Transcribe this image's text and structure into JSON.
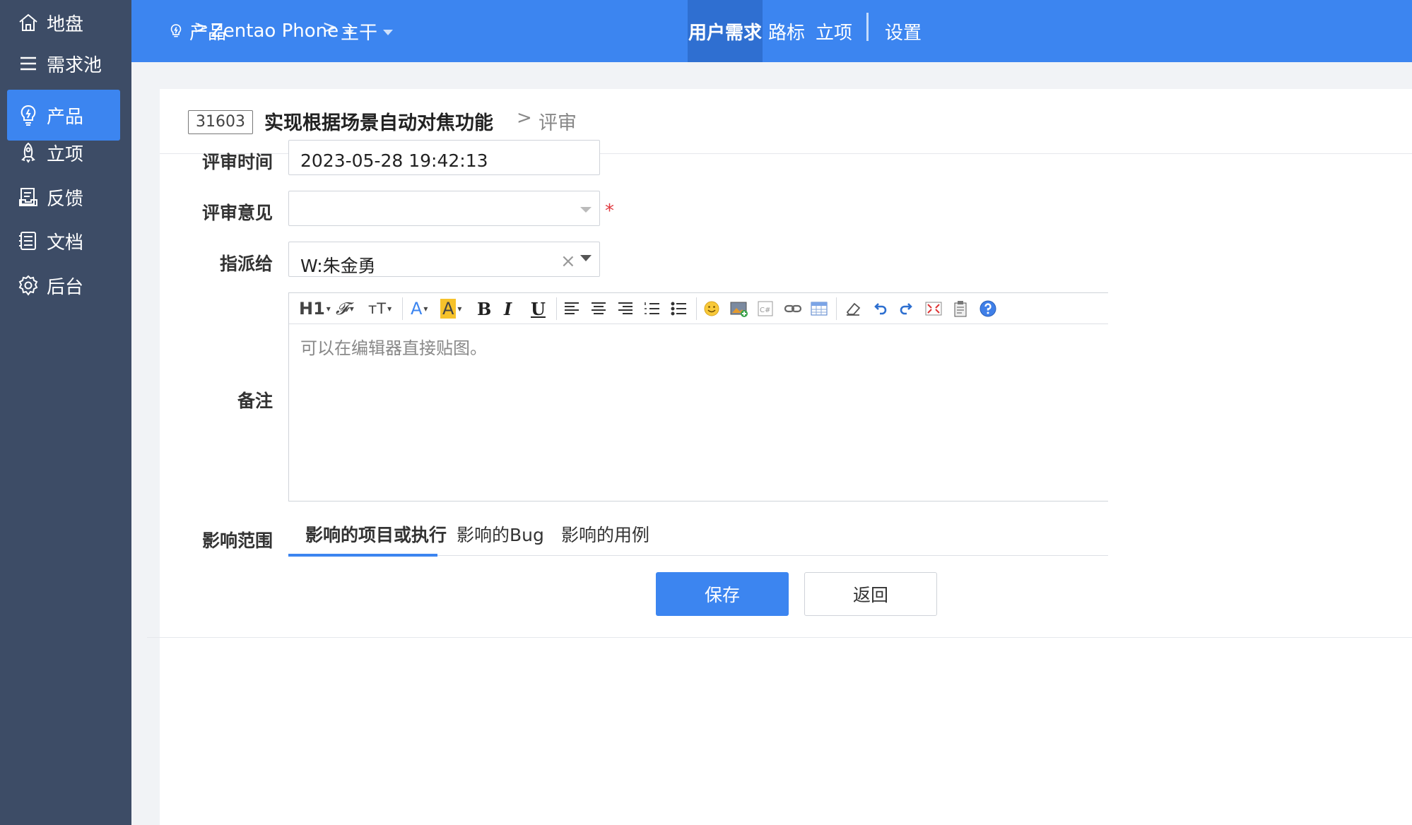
{
  "sidebar": {
    "items": [
      {
        "label": "地盘",
        "icon": "home-icon",
        "active": false
      },
      {
        "label": "需求池",
        "icon": "list-icon",
        "active": false
      },
      {
        "label": "产品",
        "icon": "lightbulb-icon",
        "active": true
      },
      {
        "label": "立项",
        "icon": "rocket-icon",
        "active": false
      },
      {
        "label": "反馈",
        "icon": "feedback-icon",
        "active": false
      },
      {
        "label": "文档",
        "icon": "document-icon",
        "active": false
      },
      {
        "label": "后台",
        "icon": "gear-icon",
        "active": false
      }
    ]
  },
  "topbar": {
    "breadcrumb": {
      "product_label": "产品",
      "product_name": "Zentao Phone",
      "branch": "主干",
      "separator": ">"
    },
    "nav": [
      {
        "label": "用户需求",
        "active": true
      },
      {
        "label": "路标",
        "active": false
      },
      {
        "label": "立项",
        "active": false
      },
      {
        "label": "设置",
        "active": false
      }
    ]
  },
  "header": {
    "id": "31603",
    "title": "实现根据场景自动对焦功能",
    "separator": ">",
    "action": "评审"
  },
  "form": {
    "review_time": {
      "label": "评审时间",
      "value": "2023-05-28 19:42:13"
    },
    "review_result": {
      "label": "评审意见",
      "value": "",
      "required_mark": "*"
    },
    "assigned_to": {
      "label": "指派给",
      "value": "W:朱金勇",
      "clear_glyph": "×"
    },
    "comment": {
      "label": "备注",
      "placeholder": "可以在编辑器直接贴图。"
    },
    "scope": {
      "label": "影响范围",
      "tabs": [
        {
          "label": "影响的项目或执行",
          "active": true
        },
        {
          "label": "影响的Bug",
          "active": false
        },
        {
          "label": "影响的用例",
          "active": false
        }
      ]
    }
  },
  "toolbar": {
    "heading": "H1",
    "font_family": "𝓕",
    "font_size": "тT",
    "font_color": "A",
    "highlight": "A",
    "bold": "B",
    "italic": "I",
    "underline": "U",
    "code_label": "C#"
  },
  "buttons": {
    "save": "保存",
    "back": "返回"
  },
  "colors": {
    "brand": "#3c85f0",
    "sidebar": "#3d4c66",
    "required": "#e0393e"
  }
}
